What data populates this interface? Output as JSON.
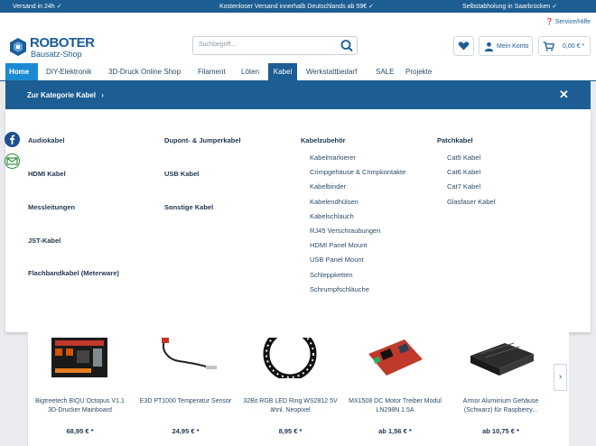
{
  "topbar": {
    "left": "Versand in 24h ✓",
    "center": "Kostenloser Versand innerhalb Deutschlands ab 59€ ✓",
    "right": "Selbstabholung in Saarbrücken ✓"
  },
  "header": {
    "service": "Service/Hilfe",
    "logo_line1": "ROBOTER",
    "logo_line2": "Bausatz-Shop",
    "search_placeholder": "Suchbegriff...",
    "account_label": "Mein Konto",
    "cart_total": "0,00 € *"
  },
  "nav": [
    "Home",
    "DIY-Elektronik",
    "3D-Druck Online Shop",
    "Filament",
    "Löten",
    "Kabel",
    "Werkstattbedarf",
    "SALE",
    "Projekte"
  ],
  "flyout": {
    "title": "Zur Kategorie Kabel",
    "close": "✕",
    "col1": [
      "Audiokabel",
      "HDMI Kabel",
      "Messleitungen",
      "JST-Kabel",
      "Flachbandkabel (Meterware)"
    ],
    "col2": [
      "Dupont- & Jumperkabel",
      "USB Kabel",
      "Sonstige Kabel"
    ],
    "col3_title": "Kabelzubehör",
    "col3_items": [
      "Kabelmarkierer",
      "Crimpgehäuse & Crimpkontakte",
      "Kabelbinder",
      "Kabelendhülsen",
      "Kabelschlauch",
      "RJ45 Verschraubungen",
      "HDMI Panel Mount",
      "USB Panel Mount",
      "Schleppketten",
      "Schrumpfschläuche"
    ],
    "col4_title": "Patchkabel",
    "col4_items": [
      "Cat5 Kabel",
      "Cat6 Kabel",
      "Cat7 Kabel",
      "Glasfaser Kabel"
    ]
  },
  "products": [
    {
      "name": "Bigtreetech BIQU Octopus V1.1 3D-Drucker Mainboard",
      "price": "68,95 € *"
    },
    {
      "name": "E3D PT1000 Temperatur Sensor",
      "price": "24,95 € *"
    },
    {
      "name": "32Bit RGB LED Ring WS2812 5V ähnl. Neopixel",
      "price": "8,95 € *"
    },
    {
      "name": "MX1508 DC Motor Treiber Modul LN298N 1.5A",
      "price": "ab 1,56 € *"
    },
    {
      "name": "Armor Aluminium Gehäuse (Schwarz) für Raspberry...",
      "price": "ab 10,75 € *"
    }
  ],
  "slider_next": "›",
  "colors": {
    "brand": "#1c5d93",
    "accent": "#1c8ad2"
  },
  "icons": [
    "roboter-logo-icon",
    "help-icon",
    "search-icon",
    "heart-icon",
    "user-icon",
    "cart-icon",
    "close-icon",
    "chevron-right-icon",
    "facebook-icon",
    "mail-icon"
  ]
}
